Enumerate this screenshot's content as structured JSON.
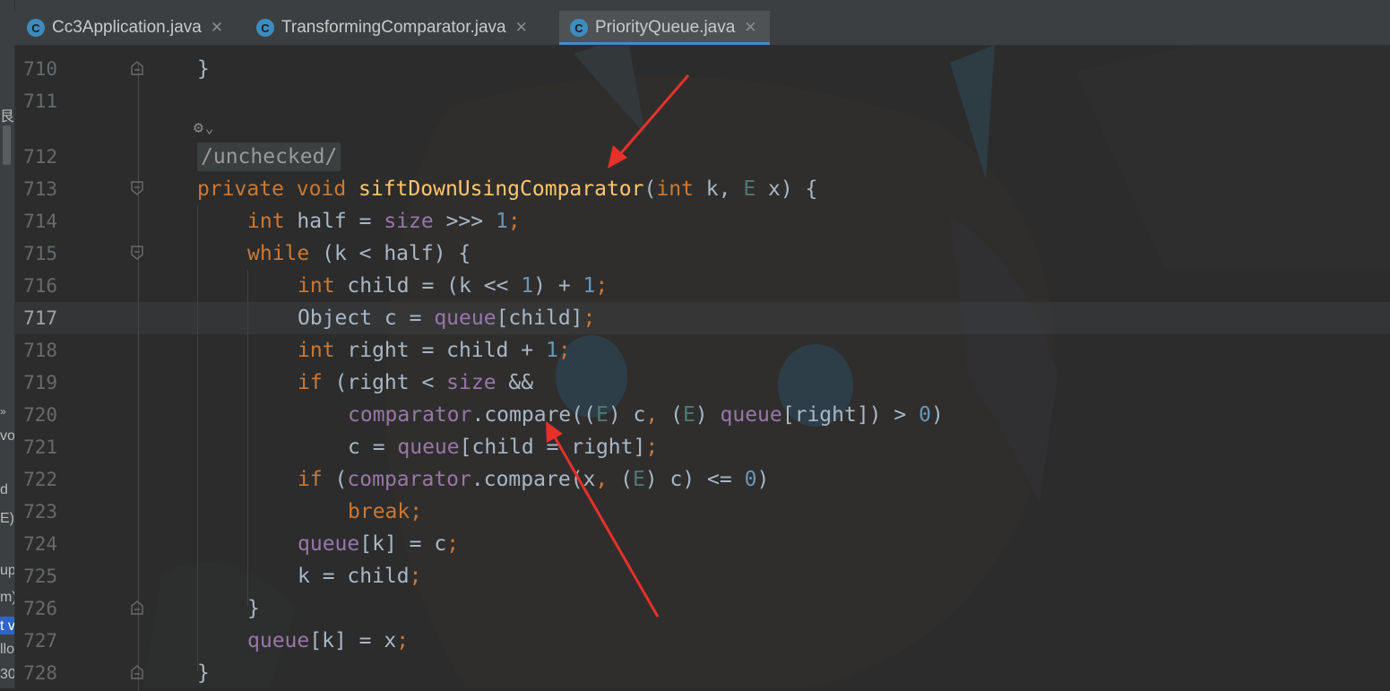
{
  "tabs": [
    {
      "label": "Cc3Application.java",
      "active": false
    },
    {
      "label": "TransformingComparator.java",
      "active": false
    },
    {
      "label": "PriorityQueue.java",
      "active": true
    }
  ],
  "left_fragments": [
    "艮",
    "»",
    "vo",
    "d",
    "E):",
    "upe",
    "m)",
    "t v",
    "llo",
    "30"
  ],
  "annotation": "/unchecked/",
  "lines": [
    {
      "n": "710"
    },
    {
      "n": "711"
    },
    {
      "n": "712"
    },
    {
      "n": "713"
    },
    {
      "n": "714"
    },
    {
      "n": "715"
    },
    {
      "n": "716"
    },
    {
      "n": "717"
    },
    {
      "n": "718"
    },
    {
      "n": "719"
    },
    {
      "n": "720"
    },
    {
      "n": "721"
    },
    {
      "n": "722"
    },
    {
      "n": "723"
    },
    {
      "n": "724"
    },
    {
      "n": "725"
    },
    {
      "n": "726"
    },
    {
      "n": "727"
    },
    {
      "n": "728"
    }
  ],
  "code_text": {
    "l710": "}",
    "l713": "private void siftDownUsingComparator(int k, E x) {",
    "l714": "int half = size >>> 1;",
    "l715": "while (k < half) {",
    "l716": "int child = (k << 1) + 1;",
    "l717": "Object c = queue[child];",
    "l718": "int right = child + 1;",
    "l719": "if (right < size &&",
    "l720": "comparator.compare((E) c, (E) queue[right]) > 0)",
    "l721": "c = queue[child = right];",
    "l722": "if (comparator.compare(x, (E) c) <= 0)",
    "l723": "break;",
    "l724": "queue[k] = c;",
    "l725": "k = child;",
    "l726": "}",
    "l727": "queue[k] = x;",
    "l728": "}"
  },
  "colors": {
    "keyword": "#cc7832",
    "method": "#ffc66d",
    "field": "#9876aa",
    "number": "#6897bb",
    "type_param": "#507874",
    "text": "#a9b7c6",
    "arrow": "#e8302a",
    "tab_icon": "#3d8cbf"
  }
}
